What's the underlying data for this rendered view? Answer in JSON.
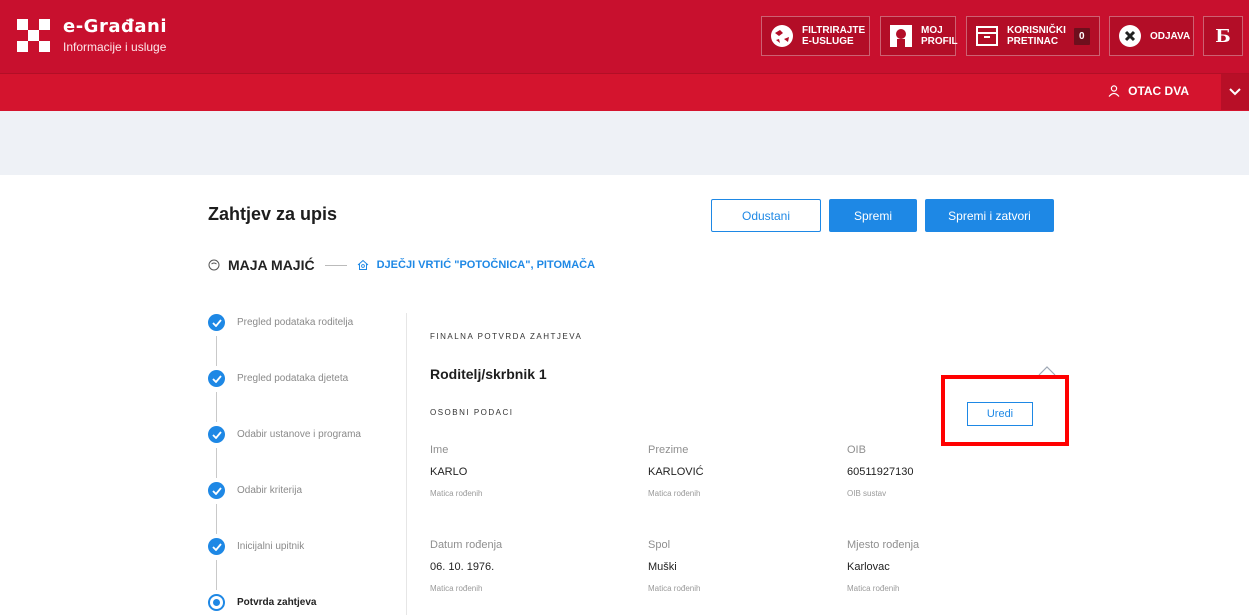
{
  "header": {
    "brand_title": "e-Građani",
    "brand_subtitle": "Informacije i usluge",
    "filter_label": "FILTRIRAJTE E-USLUGE",
    "profile_label": "MOJ PROFIL",
    "inbox_label": "KORISNIČKI PRETINAC",
    "inbox_count": "0",
    "logout_label": "ODJAVA",
    "accent": "#c8102e"
  },
  "user": {
    "name": "OTAC DVA"
  },
  "form": {
    "title": "Zahtjev za upis",
    "cancel_label": "Odustani",
    "save_label": "Spremi",
    "save_close_label": "Spremi i zatvori",
    "child_name": "MAJA MAJIĆ",
    "kindergarten": "DJEČJI VRTIĆ \"POTOČNICA\", PITOMAČA"
  },
  "steps": [
    {
      "label": "Pregled podataka roditelja",
      "state": "done"
    },
    {
      "label": "Pregled podataka djeteta",
      "state": "done"
    },
    {
      "label": "Odabir ustanove i programa",
      "state": "done"
    },
    {
      "label": "Odabir kriterija",
      "state": "done"
    },
    {
      "label": "Inicijalni upitnik",
      "state": "done"
    },
    {
      "label": "Potvrda zahtjeva",
      "state": "active"
    }
  ],
  "content": {
    "section_label": "FINALNA POTVRDA ZAHTJEVA",
    "parent_title": "Roditelj/skrbnik 1",
    "personal_label": "OSOBNI PODACI",
    "edit_label": "Uredi",
    "fields": [
      {
        "label": "Ime",
        "value": "KARLO",
        "source": "Matica rođenih"
      },
      {
        "label": "Prezime",
        "value": "KARLOVIĆ",
        "source": "Matica rođenih"
      },
      {
        "label": "OIB",
        "value": "60511927130",
        "source": "OIB sustav"
      },
      {
        "label": "Datum rođenja",
        "value": "06. 10. 1976.",
        "source": "Matica rođenih"
      },
      {
        "label": "Spol",
        "value": "Muški",
        "source": "Matica rođenih"
      },
      {
        "label": "Mjesto rođenja",
        "value": "Karlovac",
        "source": "Matica rođenih"
      }
    ]
  }
}
